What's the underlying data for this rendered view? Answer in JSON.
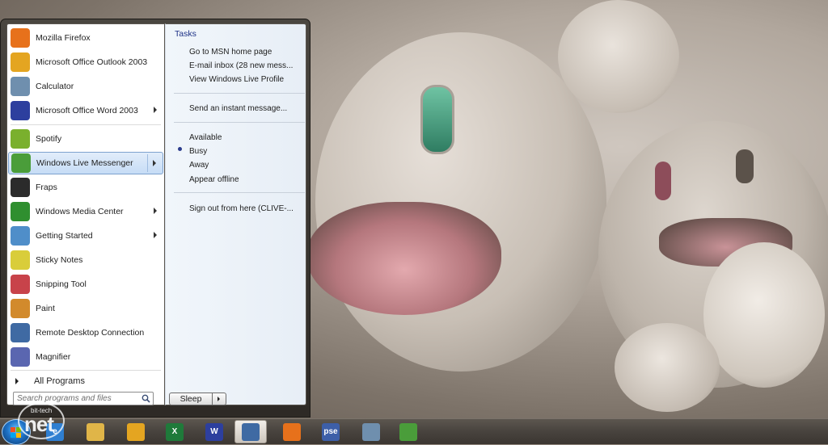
{
  "colors": {
    "accent": "#2b3c8c",
    "selected_border": "#7da2ce",
    "taskbar": "#48433e"
  },
  "start_menu": {
    "programs": [
      {
        "label": "Mozilla Firefox",
        "icon": "firefox-icon",
        "color": "#e7711b",
        "has_submenu": false
      },
      {
        "label": "Microsoft Office Outlook 2003",
        "icon": "outlook-icon",
        "color": "#e4a521",
        "has_submenu": false
      },
      {
        "label": "Calculator",
        "icon": "calculator-icon",
        "color": "#6f8fae",
        "has_submenu": false
      },
      {
        "label": "Microsoft Office Word 2003",
        "icon": "word-icon",
        "color": "#2d3f9e",
        "has_submenu": true
      },
      {
        "label": "Spotify",
        "icon": "spotify-icon",
        "color": "#7ab02d",
        "has_submenu": false
      },
      {
        "label": "Windows Live Messenger",
        "icon": "messenger-icon",
        "color": "#4a9d3a",
        "has_submenu": true,
        "selected": true
      },
      {
        "label": "Fraps",
        "icon": "fraps-icon",
        "color": "#2b2b2b",
        "has_submenu": false
      },
      {
        "label": "Windows Media Center",
        "icon": "media-center-icon",
        "color": "#2f8f2f",
        "has_submenu": true
      },
      {
        "label": "Getting Started",
        "icon": "getting-started-icon",
        "color": "#4f8ec9",
        "has_submenu": true
      },
      {
        "label": "Sticky Notes",
        "icon": "sticky-notes-icon",
        "color": "#d9cd3a",
        "has_submenu": false
      },
      {
        "label": "Snipping Tool",
        "icon": "snipping-tool-icon",
        "color": "#c8434a",
        "has_submenu": false
      },
      {
        "label": "Paint",
        "icon": "paint-icon",
        "color": "#d28a2c",
        "has_submenu": false
      },
      {
        "label": "Remote Desktop Connection",
        "icon": "remote-desktop-icon",
        "color": "#3f6aa3",
        "has_submenu": false
      },
      {
        "label": "Magnifier",
        "icon": "magnifier-icon",
        "color": "#5a66b0",
        "has_submenu": false
      }
    ],
    "all_programs": "All Programs",
    "search_placeholder": "Search programs and files",
    "sleep_label": "Sleep"
  },
  "jump_list": {
    "header": "Tasks",
    "items": [
      {
        "label": "Go to MSN home page"
      },
      {
        "label": "E-mail inbox (28 new mess..."
      },
      {
        "label": "View Windows Live Profile"
      },
      {
        "label": "Send an instant message..."
      },
      {
        "label": "Available"
      },
      {
        "label": "Busy",
        "checked": true
      },
      {
        "label": "Away"
      },
      {
        "label": "Appear offline"
      },
      {
        "label": "Sign out from here (CLIVE-..."
      }
    ]
  },
  "taskbar": {
    "items": [
      {
        "icon": "internet-explorer-icon",
        "color": "#2f7fd1",
        "glyph": "e"
      },
      {
        "icon": "file-explorer-icon",
        "color": "#e0b548",
        "glyph": ""
      },
      {
        "icon": "outlook-icon",
        "color": "#e4a521",
        "glyph": ""
      },
      {
        "icon": "excel-icon",
        "color": "#1f7a3a",
        "glyph": "X"
      },
      {
        "icon": "word-icon",
        "color": "#2d3f9e",
        "glyph": "W"
      },
      {
        "icon": "remote-desktop-icon",
        "color": "#3f6aa3",
        "glyph": "",
        "active": true
      },
      {
        "icon": "firefox-icon",
        "color": "#e7711b",
        "glyph": ""
      },
      {
        "icon": "photoshop-elements-icon",
        "color": "#3d5fa8",
        "glyph": "pse"
      },
      {
        "icon": "calculator-icon",
        "color": "#6f8fae",
        "glyph": ""
      },
      {
        "icon": "messenger-icon",
        "color": "#4a9d3a",
        "glyph": ""
      }
    ]
  },
  "watermark": {
    "small": "bit-tech",
    "big": "net"
  }
}
